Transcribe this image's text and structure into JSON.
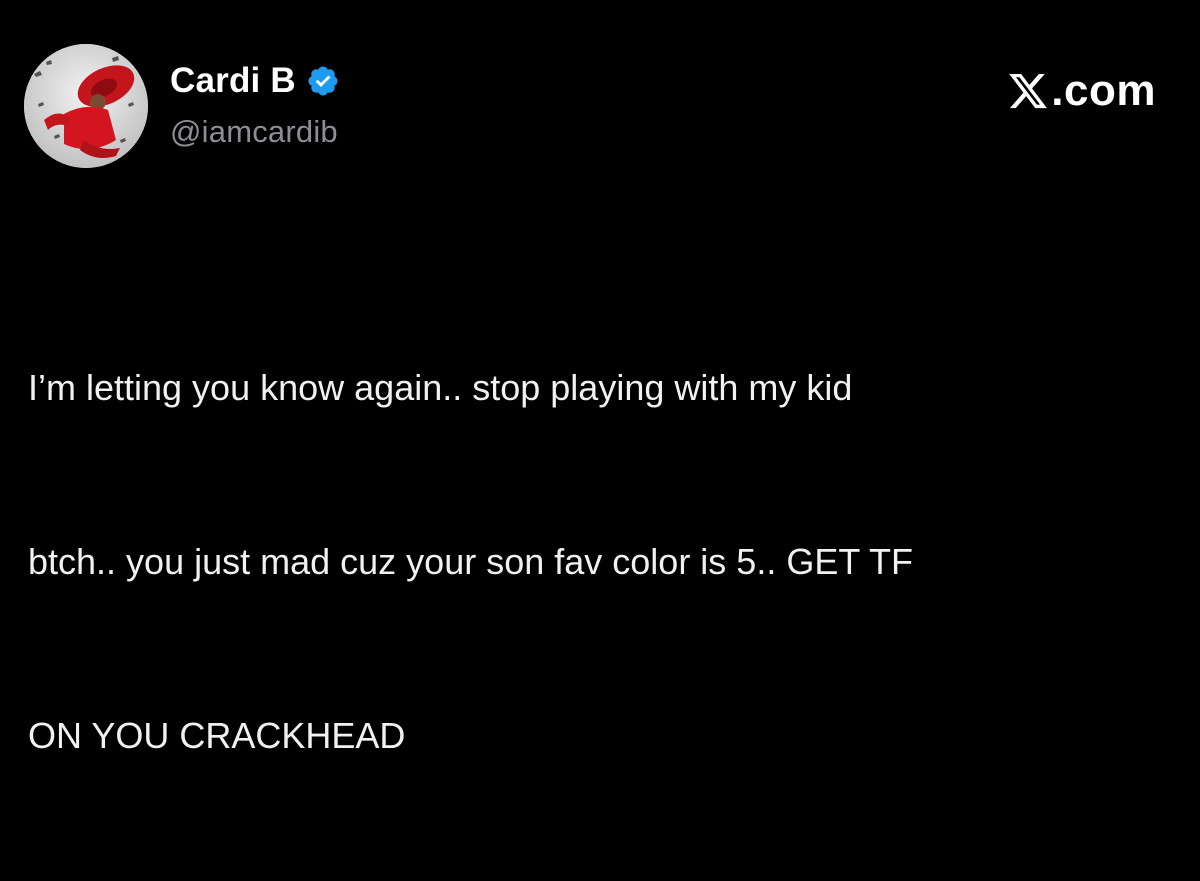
{
  "author": {
    "display_name": "Cardi B",
    "handle": "@iamcardib",
    "verified": true,
    "verified_color": "#1d9bf0"
  },
  "brand": {
    "icon": "x-logo-icon",
    "text": ".com"
  },
  "tweet": {
    "lines": [
      "I’m letting you know again.. stop playing with my kid",
      "btch.. you just mad cuz your son fav color is 5.. GET TF",
      "ON YOU CRACKHEAD"
    ]
  },
  "colors": {
    "background": "#000000",
    "text": "#f1f1f1",
    "handle": "#8b8f94"
  }
}
